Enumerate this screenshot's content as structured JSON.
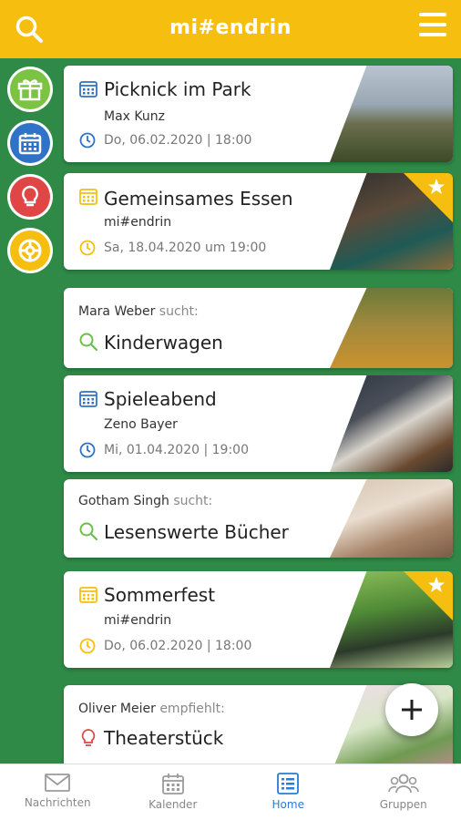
{
  "app": {
    "title": "mi#endrin"
  },
  "colors": {
    "header": "#f6bf10",
    "background": "#2f8a47",
    "active_nav": "#2b7cd3"
  },
  "header_icons": {
    "search": "search-icon",
    "menu": "hamburger-menu-icon"
  },
  "side_buttons": [
    {
      "icon": "gift-icon",
      "color": "#7cc243"
    },
    {
      "icon": "calendar-icon",
      "color": "#2f73c8"
    },
    {
      "icon": "lightbulb-icon",
      "color": "#e04646"
    },
    {
      "icon": "lifebuoy-icon",
      "color": "#f6bf10"
    }
  ],
  "cards": [
    {
      "kind": "event",
      "title": "Picknick im Park",
      "organizer": "Max Kunz",
      "date": "Do, 06.02.2020 | 18:00",
      "accent": "#2f73c8",
      "starred": false,
      "photo": "city-park-photo"
    },
    {
      "kind": "event",
      "title": "Gemeinsames Essen",
      "organizer": "mi#endrin",
      "date": "Sa, 18.04.2020 um 19:00",
      "accent": "#f6bf10",
      "starred": true,
      "photo": "dinner-photo"
    },
    {
      "kind": "search",
      "person": "Mara Weber",
      "verb": "sucht:",
      "title": "Kinderwagen",
      "accent": "#6cbf4a",
      "photo": "family-walk-photo"
    },
    {
      "kind": "event",
      "title": "Spieleabend",
      "organizer": "Zeno Bayer",
      "date": "Mi, 01.04.2020 | 19:00",
      "accent": "#2f73c8",
      "starred": false,
      "photo": "chess-photo"
    },
    {
      "kind": "search",
      "person": "Gotham Singh",
      "verb": "sucht:",
      "title": "Lesenswerte Bücher",
      "accent": "#6cbf4a",
      "photo": "book-photo"
    },
    {
      "kind": "event",
      "title": "Sommerfest",
      "organizer": "mi#endrin",
      "date": "Do, 06.02.2020 | 18:00",
      "accent": "#f6bf10",
      "starred": true,
      "photo": "berries-photo"
    },
    {
      "kind": "recommend",
      "person": "Oliver Meier",
      "verb": "empfiehlt:",
      "title": "Theaterstück",
      "accent": "#e04646",
      "photo": "succulent-photo"
    }
  ],
  "fab": {
    "icon": "plus-icon"
  },
  "bottom_nav": [
    {
      "label": "Nachrichten",
      "icon": "envelope-icon",
      "active": false
    },
    {
      "label": "Kalender",
      "icon": "calendar-icon",
      "active": false
    },
    {
      "label": "Home",
      "icon": "home-list-icon",
      "active": true
    },
    {
      "label": "Gruppen",
      "icon": "group-icon",
      "active": false
    }
  ]
}
